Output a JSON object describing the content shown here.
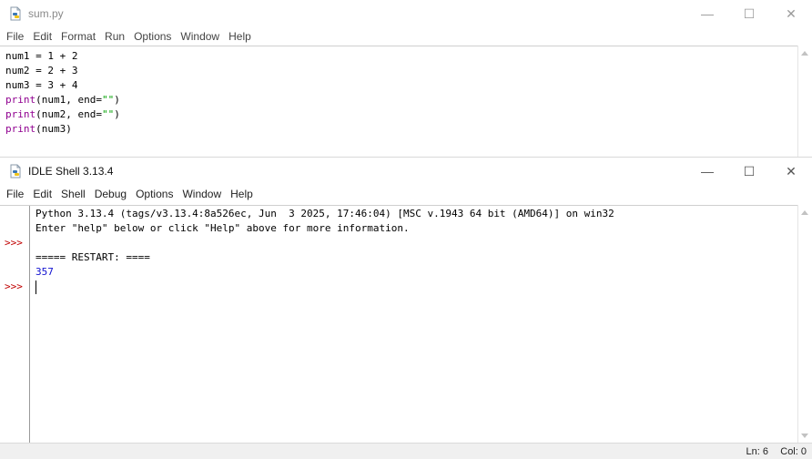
{
  "editor": {
    "title": "sum.py",
    "menu": [
      "File",
      "Edit",
      "Format",
      "Run",
      "Options",
      "Window",
      "Help"
    ],
    "code_lines": [
      [
        {
          "t": "num1 = 1 + 2",
          "c": ""
        }
      ],
      [
        {
          "t": "num2 = 2 + 3",
          "c": ""
        }
      ],
      [
        {
          "t": "num3 = 3 + 4",
          "c": ""
        }
      ],
      [
        {
          "t": "print",
          "c": "kw"
        },
        {
          "t": "(num1, end=",
          "c": ""
        },
        {
          "t": "\"\"",
          "c": "str"
        },
        {
          "t": ")",
          "c": ""
        }
      ],
      [
        {
          "t": "print",
          "c": "kw"
        },
        {
          "t": "(num2, end=",
          "c": ""
        },
        {
          "t": "\"\"",
          "c": "str"
        },
        {
          "t": ")",
          "c": ""
        }
      ],
      [
        {
          "t": "print",
          "c": "kw"
        },
        {
          "t": "(num3)",
          "c": ""
        }
      ]
    ]
  },
  "shell": {
    "title": "IDLE Shell 3.13.4",
    "menu": [
      "File",
      "Edit",
      "Shell",
      "Debug",
      "Options",
      "Window",
      "Help"
    ],
    "prompt": ">>>",
    "lines": [
      {
        "text": "Python 3.13.4 (tags/v3.13.4:8a526ec, Jun  3 2025, 17:46:04) [MSC v.1943 64 bit (AMD64)] on win32",
        "kind": "info"
      },
      {
        "text": "Enter \"help\" below or click \"Help\" above for more information.",
        "kind": "info"
      },
      {
        "text": "",
        "kind": "prompt"
      },
      {
        "text": "===== RESTART: ====",
        "kind": "info"
      },
      {
        "text": "357",
        "kind": "output"
      },
      {
        "text": "",
        "kind": "prompt"
      }
    ],
    "status": {
      "line": "Ln: 6",
      "col": "Col: 0"
    }
  },
  "window_controls": {
    "minimize": "—",
    "maximize": "☐",
    "close": "✕"
  },
  "colors": {
    "keyword": "#900090",
    "string": "#00a000",
    "output": "#1010d0",
    "prompt": "#c00000"
  }
}
